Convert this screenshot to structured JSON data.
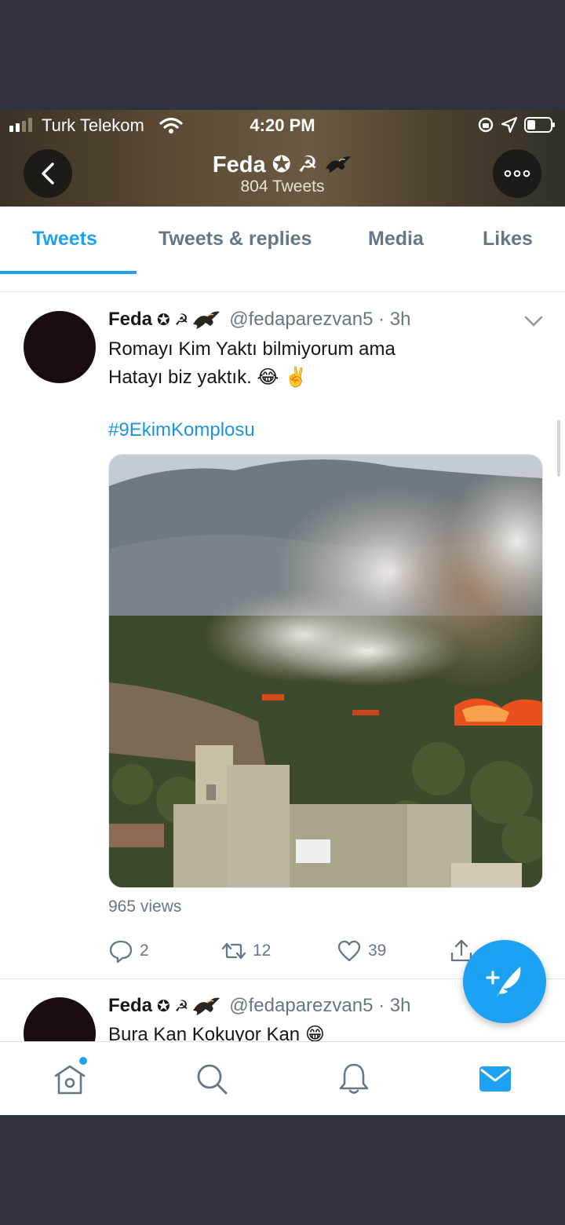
{
  "status_bar": {
    "carrier": "Turk Telekom",
    "time": "4:20 PM"
  },
  "profile_header": {
    "name": "Feda ✪ ☭",
    "tweet_count": "804 Tweets"
  },
  "tabs": [
    {
      "label": "Tweets",
      "active": true
    },
    {
      "label": "Tweets & replies",
      "active": false
    },
    {
      "label": "Media",
      "active": false
    },
    {
      "label": "Likes",
      "active": false
    }
  ],
  "tweets": [
    {
      "name": "Feda",
      "badges": "✪ ☭",
      "handle_time": "@fedaparezvan5 · 3h",
      "text_line1": "Romayı Kim Yaktı bilmiyorum ama",
      "text_line2": "Hatayı biz yaktık. 😂 ✌️",
      "hashtag": "#9EkimKomplosu",
      "views": "965 views",
      "replies": "2",
      "retweets": "12",
      "likes": "39"
    },
    {
      "name": "Feda",
      "badges": "✪ ☭",
      "handle_time": "@fedaparezvan5 · 3h",
      "text_line1": "Bura Kan Kokuyor Kan 😁"
    }
  ],
  "colors": {
    "accent": "#1da1f2",
    "hashtag": "#1b95e0",
    "secondary_text": "#657786"
  },
  "icons": [
    "back-arrow-icon",
    "more-icon",
    "dropdown-chevron-icon",
    "reply-icon",
    "retweet-icon",
    "like-icon",
    "share-icon",
    "compose-tweet-icon",
    "home-icon",
    "search-icon",
    "notifications-icon",
    "messages-icon"
  ]
}
